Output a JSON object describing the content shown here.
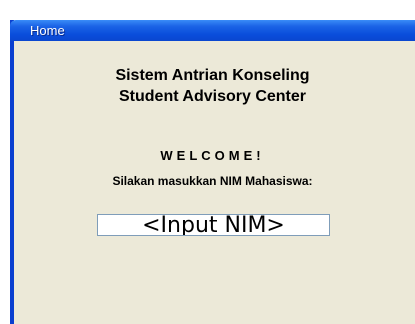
{
  "window": {
    "title": "Home"
  },
  "main": {
    "heading_line1": "Sistem Antrian Konseling",
    "heading_line2": "Student Advisory Center",
    "welcome": "WELCOME!",
    "prompt": "Silakan masukkan NIM Mahasiswa:",
    "nim_input": {
      "value": "",
      "placeholder": "<Input NIM>"
    }
  },
  "colors": {
    "titlebar": "#0a4ddb",
    "window_bg": "#ece9d8",
    "border": "#0a3fd0"
  }
}
